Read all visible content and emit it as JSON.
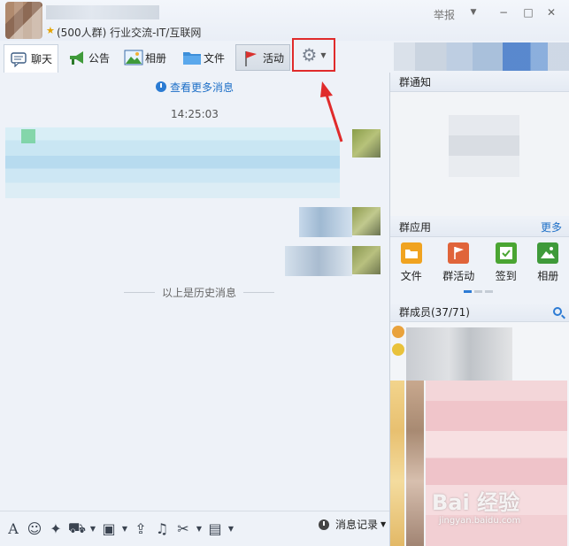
{
  "window": {
    "group_title": "(500人群) 行业交流-IT/互联网",
    "report_label": "举报",
    "minimize": "−",
    "maximize": "□",
    "close": "✕",
    "menu_arrow": "▼"
  },
  "tabs": [
    {
      "label": "聊天",
      "icon": "chat-bubble-icon"
    },
    {
      "label": "公告",
      "icon": "megaphone-icon"
    },
    {
      "label": "相册",
      "icon": "photo-album-icon"
    },
    {
      "label": "文件",
      "icon": "folder-icon"
    },
    {
      "label": "活动",
      "icon": "flag-icon"
    }
  ],
  "settings": {
    "icon": "gear-icon",
    "dropdown": "▼"
  },
  "chat": {
    "more_messages": "查看更多消息",
    "timestamp": "14:25:03",
    "history_divider": "以上是历史消息"
  },
  "toolbar": {
    "items": [
      "font-icon",
      "emoji-icon",
      "magic-wand-icon",
      "screenshot-icon",
      "image-icon",
      "upload-icon",
      "music-icon",
      "scissors-icon",
      "gift-icon"
    ],
    "history_label": "消息记录"
  },
  "right_panel": {
    "notice_title": "群通知",
    "apps_title": "群应用",
    "more_label": "更多",
    "apps": [
      {
        "label": "文件",
        "icon": "folder-icon",
        "color": "#f0a320"
      },
      {
        "label": "群活动",
        "icon": "flag-icon",
        "color": "#e0643a"
      },
      {
        "label": "签到",
        "icon": "checkmark-icon",
        "color": "#4aa532"
      },
      {
        "label": "相册",
        "icon": "photo-album-icon",
        "color": "#3f9a3a"
      }
    ],
    "members_title": "群成员(37/71)"
  },
  "watermark": {
    "brand": "Bai 经验",
    "url": "jingyan.baidu.com"
  },
  "colors": {
    "accent": "#1d6fc7",
    "highlight": "#e02b2b"
  }
}
